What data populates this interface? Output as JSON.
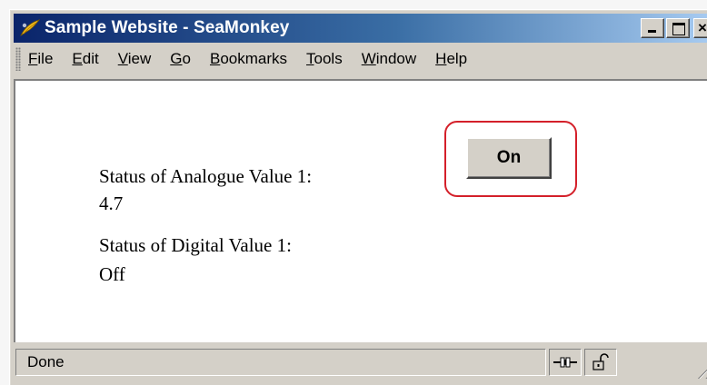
{
  "window": {
    "title": "Sample Website - SeaMonkey",
    "icon": "seamonkey-icon",
    "controls": [
      "minimize-icon",
      "maximize-icon",
      "close-icon"
    ]
  },
  "menubar": {
    "items": [
      {
        "label": "File",
        "accel": "F",
        "rest": "ile"
      },
      {
        "label": "Edit",
        "accel": "E",
        "rest": "dit"
      },
      {
        "label": "View",
        "accel": "V",
        "rest": "iew"
      },
      {
        "label": "Go",
        "accel": "G",
        "rest": "o"
      },
      {
        "label": "Bookmarks",
        "accel": "B",
        "rest": "ookmarks"
      },
      {
        "label": "Tools",
        "accel": "T",
        "rest": "ools"
      },
      {
        "label": "Window",
        "accel": "W",
        "rest": "indow"
      },
      {
        "label": "Help",
        "accel": "H",
        "rest": "elp"
      }
    ]
  },
  "content": {
    "analogue_label": "Status of Analogue Value 1:",
    "analogue_value": "4.7",
    "digital_label": "Status of Digital Value 1:",
    "digital_value": "Off",
    "toggle_button_label": "On",
    "highlight_color": "#d4202a"
  },
  "statusbar": {
    "text": "Done",
    "icons": [
      "connection-icon",
      "padlock-open-icon"
    ]
  }
}
